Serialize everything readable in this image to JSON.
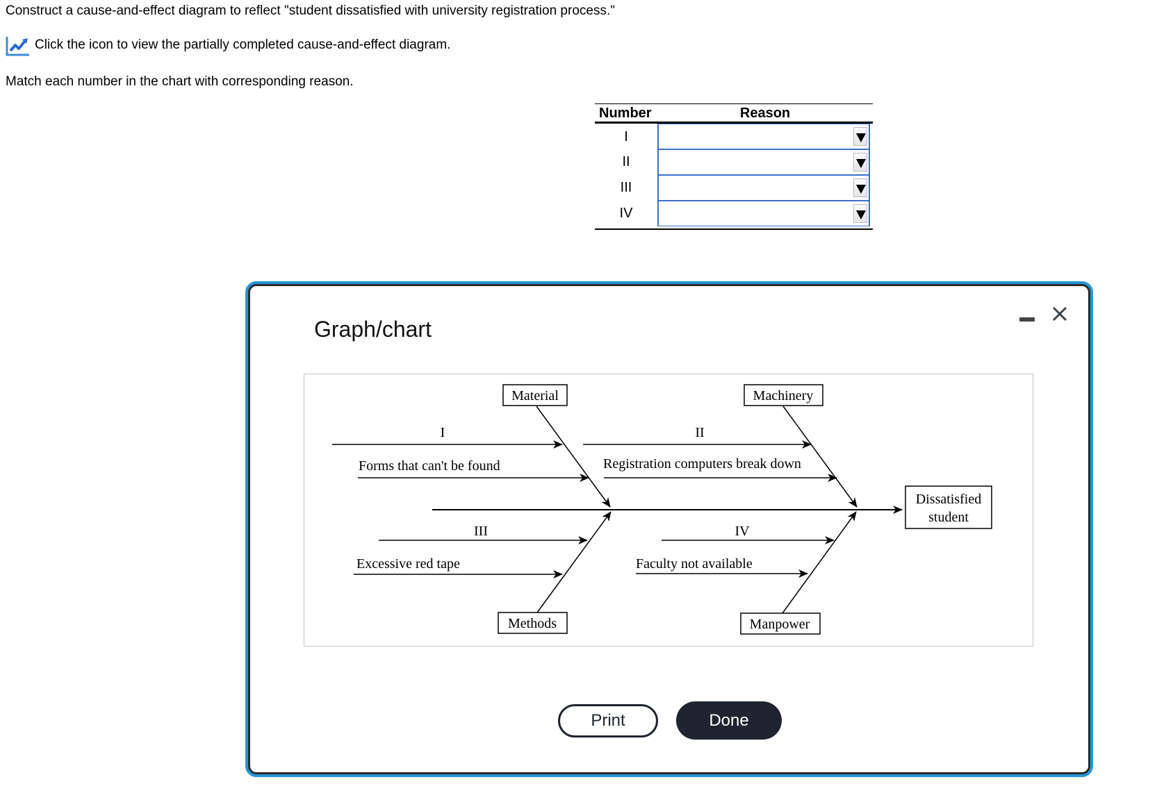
{
  "question": {
    "prompt": "Construct a cause-and-effect diagram to reflect \"student dissatisfied with university registration process.\"",
    "icon_link_text": "Click the icon to view the partially completed cause-and-effect diagram.",
    "icon": "trending-chart-icon",
    "instruction": "Match each number in the chart with corresponding reason."
  },
  "match_table": {
    "headers": {
      "number": "Number",
      "reason": "Reason"
    },
    "rows": [
      {
        "number": "I",
        "reason_selected": ""
      },
      {
        "number": "II",
        "reason_selected": ""
      },
      {
        "number": "III",
        "reason_selected": ""
      },
      {
        "number": "IV",
        "reason_selected": ""
      }
    ],
    "dropdown_icon": "triangle-down-icon"
  },
  "modal": {
    "title": "Graph/chart",
    "minimize_icon": "minimize-icon",
    "close_icon": "close-icon",
    "buttons": {
      "print": "Print",
      "done": "Done"
    },
    "accent_color": "#2596d6",
    "button_dark_color": "#1e2430"
  },
  "diagram": {
    "effect": [
      "Dissatisfied",
      "student"
    ],
    "categories": {
      "top_left": "Material",
      "top_right": "Machinery",
      "bottom_left": "Methods",
      "bottom_right": "Manpower"
    },
    "causes": {
      "material": [
        "I",
        "Forms that can't be found"
      ],
      "machinery": [
        "II",
        "Registration computers break down"
      ],
      "methods": [
        "III",
        "Excessive red tape"
      ],
      "manpower": [
        "IV",
        "Faculty not available"
      ]
    }
  }
}
